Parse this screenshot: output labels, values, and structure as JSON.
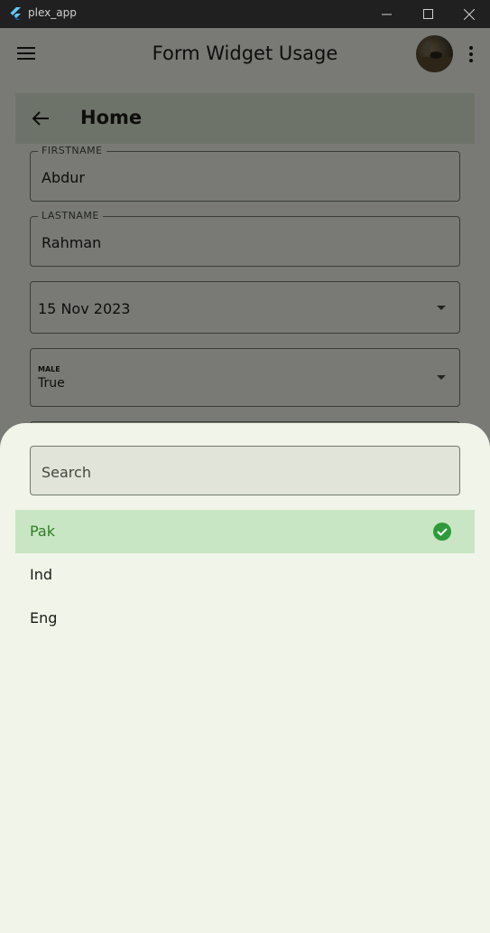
{
  "window": {
    "title": "plex_app"
  },
  "appbar": {
    "title": "Form Widget Usage"
  },
  "page": {
    "title": "Home"
  },
  "form": {
    "firstname": {
      "label": "FIRSTNAME",
      "value": "Abdur"
    },
    "lastname": {
      "label": "LASTNAME",
      "value": "Rahman"
    },
    "date": {
      "value": "15 Nov 2023"
    },
    "gender": {
      "label": "MALE",
      "value": "True"
    }
  },
  "sheet": {
    "search": {
      "placeholder": "Search"
    },
    "options": [
      {
        "label": "Pak",
        "selected": true
      },
      {
        "label": "Ind",
        "selected": false
      },
      {
        "label": "Eng",
        "selected": false
      }
    ]
  },
  "colors": {
    "accent": "#2e7d24",
    "selected_bg": "#c8e6c3",
    "surface": "#f2f5ec"
  }
}
